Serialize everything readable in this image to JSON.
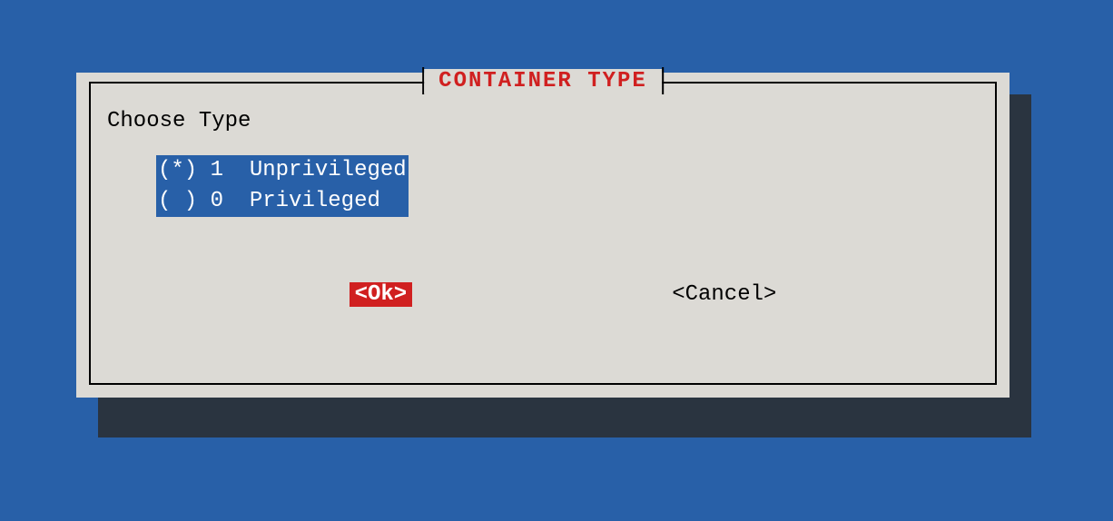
{
  "dialog": {
    "title": "CONTAINER TYPE",
    "prompt": "Choose Type",
    "options": [
      {
        "mark": "(*)",
        "value": "1",
        "label": "Unprivileged",
        "selected": true
      },
      {
        "mark": "( )",
        "value": "0",
        "label": "Privileged",
        "selected": false
      }
    ],
    "buttons": {
      "ok": "<Ok>",
      "cancel": "<Cancel>"
    }
  }
}
